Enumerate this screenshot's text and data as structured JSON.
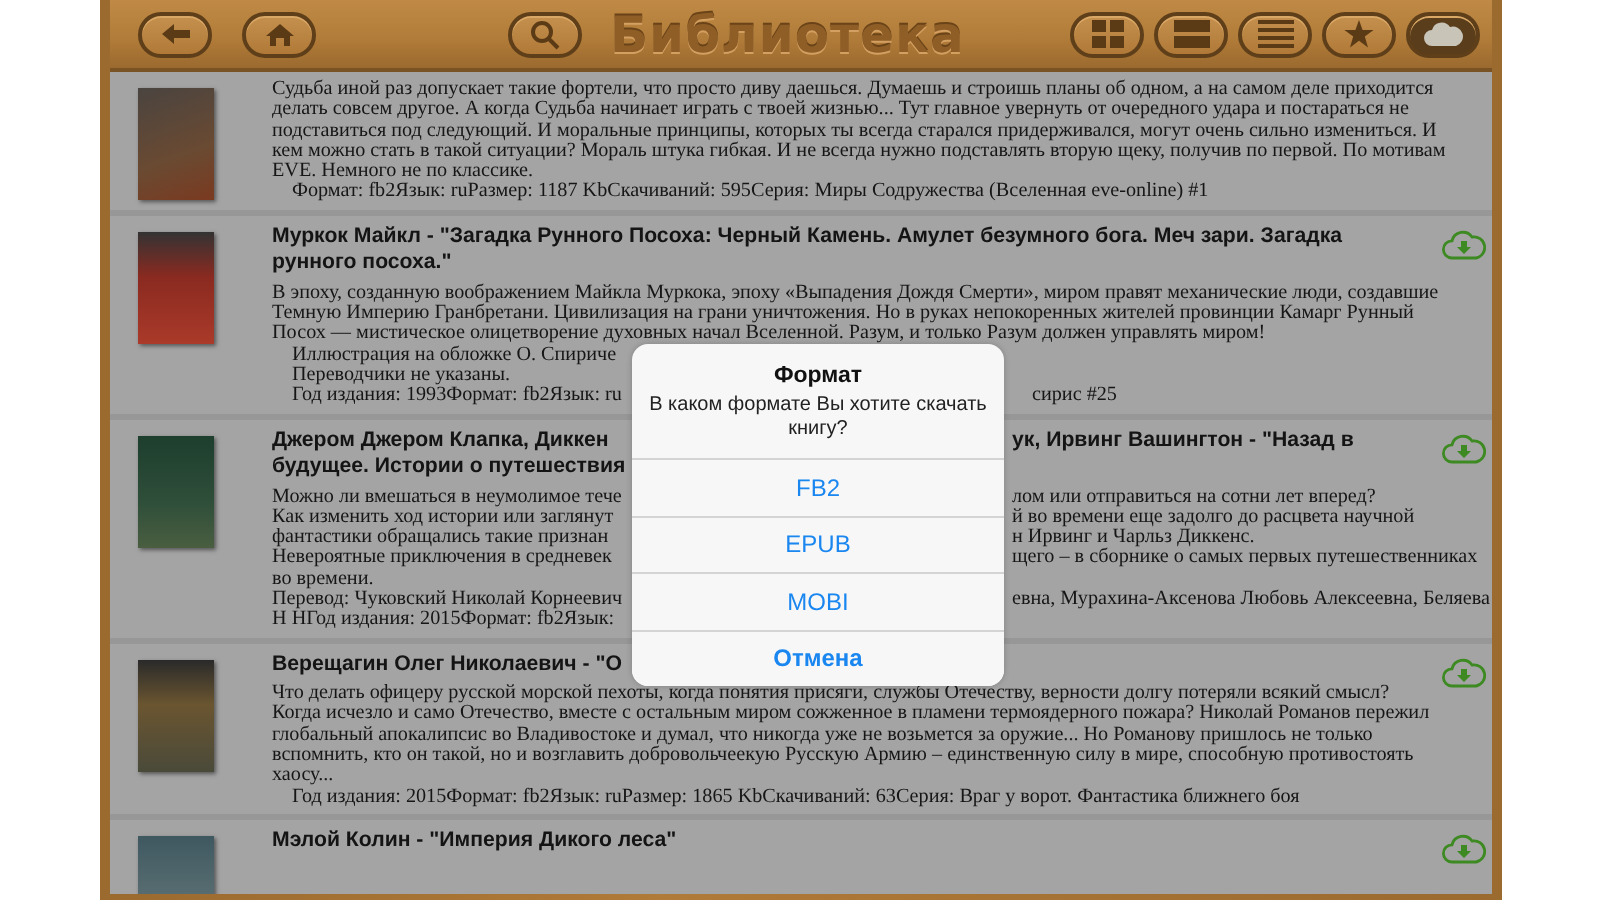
{
  "header": {
    "title": "Библиотека",
    "left_buttons": [
      {
        "kind": "back"
      },
      {
        "kind": "home"
      },
      {
        "kind": "search"
      }
    ],
    "right_buttons": [
      {
        "kind": "grid",
        "selected": false
      },
      {
        "kind": "rows",
        "selected": false
      },
      {
        "kind": "list",
        "selected": false
      },
      {
        "kind": "star",
        "selected": false
      },
      {
        "kind": "cloud",
        "selected": true
      }
    ]
  },
  "books": [
    {
      "lines": [
        {
          "kind": "text",
          "left": "Судьба иной раз допускает такие фортели, что просто диву даешься. Думаешь и строишь планы об одном, а на самом деле приходится"
        },
        {
          "kind": "text",
          "left": "делать совсем другое. А когда Судьба начинает играть с твоей жизнью... Тут главное увернуть от очередного удара и постараться не"
        },
        {
          "kind": "text",
          "left": "подставиться под следующий. И моральные принципы, которых ты всегда старался придерживался, могут очень сильно измениться. И"
        },
        {
          "kind": "text",
          "left": "кем можно стать в такой ситуации? Мораль штука гибкая. И не всегда нужно подставлять вторую щеку, получив по первой. По мотивам"
        },
        {
          "kind": "text",
          "left": "EVE. Немного не по классике."
        },
        {
          "kind": "note",
          "left": "Формат: fb2Язык: ruРазмер: 1187 KbСкачиваний: 595Серия: Миры Содружества (Вселенная eve-online) #1"
        }
      ]
    },
    {
      "download": true,
      "title_lines": [
        {
          "left": "Муркок Майкл - \"Загадка Рунного Посоха: Черный Камень. Амулет безумного бога. Меч зари. Загадка"
        },
        {
          "left": "рунного посоха.\""
        }
      ],
      "lines": [
        {
          "kind": "text",
          "left": "В эпоху, созданную воображением Майкла Муркока, эпоху «Выпадения Дождя Смерти», миром правят механические люди, создавшие"
        },
        {
          "kind": "text",
          "left": "Темную Империю Гранбретани. Цивилизация на грани уничтожения. Но в руках непокоренных жителей провинции Камарг Рунный"
        },
        {
          "kind": "text",
          "left": "Посох — мистическое олицетворение духовных начал Вселенной. Разум, и только Разум должен управлять миром!"
        },
        {
          "kind": "note",
          "left": "Иллюстрация на обложке О. Спириче"
        },
        {
          "kind": "note",
          "left": "Переводчики не указаны."
        },
        {
          "kind": "note",
          "left": "Год издания: 1993Формат: fb2Язык: ru",
          "right": "сирис #25"
        }
      ]
    },
    {
      "download": true,
      "title_lines": [
        {
          "left": "Джером Джером Клапка, Диккен",
          "right": "ук, Ирвинг Вашингтон - \"Назад в"
        },
        {
          "left": "будущее. Истории о путешествия"
        }
      ],
      "lines": [
        {
          "kind": "text",
          "left": "Можно ли вмешаться в неумолимое тече",
          "right": "лом или отправиться на сотни лет вперед?"
        },
        {
          "kind": "text",
          "left": "Как изменить ход истории или заглянут",
          "right": "й во времени еще задолго до расцвета научной"
        },
        {
          "kind": "text",
          "left": "фантастики обращались такие признан",
          "right": "н Ирвинг и Чарльз Диккенс."
        },
        {
          "kind": "text",
          "left": "Невероятные приключения в средневек",
          "right": "щего – в сборнике о самых первых путешественниках"
        },
        {
          "kind": "text",
          "left": "во времени."
        },
        {
          "kind": "text",
          "left": "Перевод: Чуковский Николай Корнеевич",
          "right": "евна, Мурахина-Аксенова Любовь Алексеевна, Беляева"
        },
        {
          "kind": "text",
          "left": "Н НГод издания: 2015Формат: fb2Язык:"
        }
      ]
    },
    {
      "download": true,
      "title_lines": [
        {
          "left": "Верещагин Олег Николаевич - \"О"
        }
      ],
      "lines": [
        {
          "kind": "text",
          "left": "Что делать офицеру русской морской пехоты, когда понятия присяги, службы Отечеству, верности долгу потеряли всякий смысл?"
        },
        {
          "kind": "text",
          "left": "Когда исчезло и само Отечество, вместе с остальным миром сожженное в пламени термоядерного пожара? Николай Романов пережил"
        },
        {
          "kind": "text",
          "left": "глобальный апокалипсис во Владивостоке и думал, что никогда уже не возьмется за оружие... Но Романову пришлось не только"
        },
        {
          "kind": "text",
          "left": "вспомнить, кто он такой, но и возглавить добровольчеекую Русскую Армию – единственную силу в мире, способную противостоять"
        },
        {
          "kind": "text",
          "left": "хаосу..."
        },
        {
          "kind": "note",
          "left": "Год издания: 2015Формат: fb2Язык: ruРазмер: 1865 KbСкачиваний: 63Серия: Враг у ворот. Фантастика ближнего боя"
        }
      ]
    },
    {
      "download": true,
      "title_lines": [
        {
          "left": "Мэлой Колин - \"Империя Дикого леса\""
        }
      ]
    }
  ],
  "dialog": {
    "title": "Формат",
    "message": "В каком формате Вы хотите скачать книгу?",
    "options": [
      {
        "label": "FB2",
        "kind": "option"
      },
      {
        "label": "EPUB",
        "kind": "option"
      },
      {
        "label": "MOBI",
        "kind": "option"
      },
      {
        "label": "Отмена",
        "kind": "cancel"
      }
    ]
  }
}
